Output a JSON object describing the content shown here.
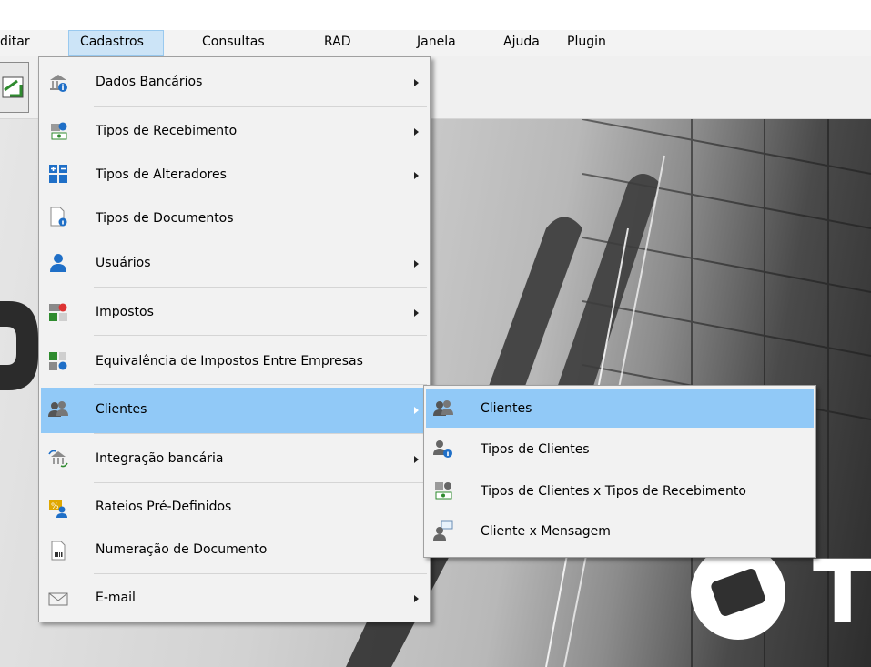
{
  "menubar": {
    "items": [
      {
        "label": "ditar"
      },
      {
        "label": "Cadastros"
      },
      {
        "label": "Consultas"
      },
      {
        "label": "RAD"
      },
      {
        "label": "Janela"
      },
      {
        "label": "Ajuda"
      },
      {
        "label": "Plugin"
      }
    ]
  },
  "brand": {
    "letter": "T"
  },
  "cadastros_menu": {
    "items": [
      {
        "label": "Dados Bancários",
        "icon": "bank-info-icon",
        "has_submenu": true
      },
      {
        "label": "Tipos de Recebimento",
        "icon": "money-receipt-icon",
        "has_submenu": true
      },
      {
        "label": "Tipos de Alteradores",
        "icon": "calculator-icon",
        "has_submenu": true
      },
      {
        "label": "Tipos de Documentos",
        "icon": "document-info-icon",
        "has_submenu": false
      },
      {
        "label": "Usuários",
        "icon": "user-icon",
        "has_submenu": true
      },
      {
        "label": "Impostos",
        "icon": "tax-icon",
        "has_submenu": true
      },
      {
        "label": "Equivalência de Impostos Entre Empresas",
        "icon": "tax-equivalence-icon",
        "has_submenu": false
      },
      {
        "label": "Clientes",
        "icon": "clients-icon",
        "has_submenu": true
      },
      {
        "label": "Integração bancária",
        "icon": "bank-integration-icon",
        "has_submenu": true
      },
      {
        "label": "Rateios Pré-Definidos",
        "icon": "apportionment-icon",
        "has_submenu": false
      },
      {
        "label": "Numeração de Documento",
        "icon": "document-number-icon",
        "has_submenu": false
      },
      {
        "label": "E-mail",
        "icon": "envelope-icon",
        "has_submenu": true
      }
    ]
  },
  "clientes_submenu": {
    "items": [
      {
        "label": "Clientes",
        "icon": "clients-icon"
      },
      {
        "label": "Tipos de Clientes",
        "icon": "client-types-icon"
      },
      {
        "label": "Tipos de Clientes x Tipos de Recebimento",
        "icon": "client-receipt-icon"
      },
      {
        "label": "Cliente x Mensagem",
        "icon": "client-message-icon"
      }
    ]
  },
  "colors": {
    "menu_highlight": "#91c9f7",
    "menubar_open": "#cce4f7",
    "menu_bg": "#f2f2f2"
  }
}
